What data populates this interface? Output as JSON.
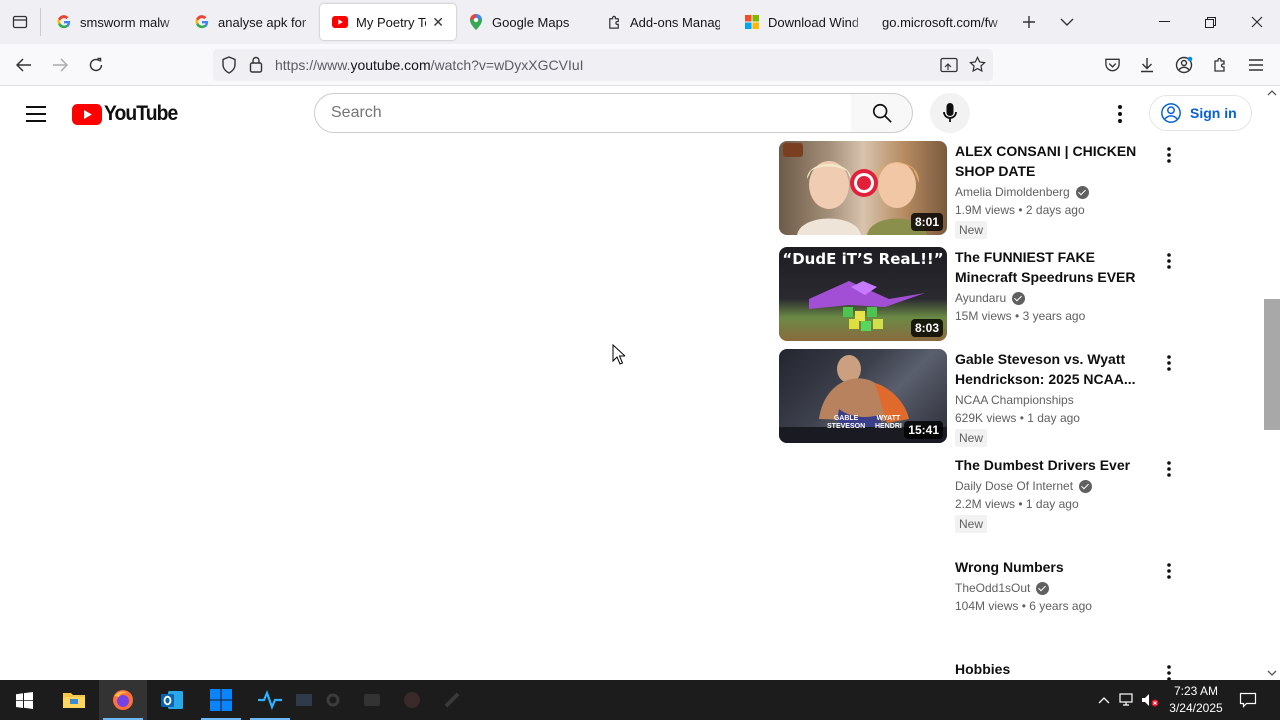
{
  "browser": {
    "tabs": [
      {
        "title": "smsworm malware",
        "favicon": "google-g-icon",
        "active": false
      },
      {
        "title": "analyse apk for malware",
        "favicon": "google-g-icon",
        "active": false
      },
      {
        "title": "My Poetry Teacher",
        "favicon": "youtube-icon",
        "active": true,
        "close": "✕"
      },
      {
        "title": "Google Maps",
        "favicon": "maps-pin-icon",
        "active": false
      },
      {
        "title": "Add-ons Manager",
        "favicon": "puzzle-icon",
        "active": false
      },
      {
        "title": "Download Windows",
        "favicon": "microsoft-icon",
        "active": false
      },
      {
        "title": "go.microsoft.com/fwlink",
        "favicon": "none",
        "active": false
      }
    ],
    "url_prefix": "https://www.",
    "url_domain": "youtube.com",
    "url_path": "/watch?v=wDyxXGCVIuI"
  },
  "youtube": {
    "logo_text": "YouTube",
    "search_placeholder": "Search",
    "signin_label": "Sign in"
  },
  "videos": [
    {
      "title": "ALEX CONSANI | CHICKEN SHOP DATE",
      "channel": "Amelia Dimoldenberg",
      "verified": true,
      "views": "1.9M views",
      "age": "2 days ago",
      "badge": "New",
      "duration": "8:01",
      "thumb": true
    },
    {
      "title": "The FUNNIEST FAKE Minecraft Speedruns EVER",
      "channel": "Ayundaru",
      "verified": true,
      "views": "15M views",
      "age": "3 years ago",
      "badge": "",
      "duration": "8:03",
      "thumb": true,
      "thumb_text": "“DudE iT’S ReaL!!”"
    },
    {
      "title": "Gable Steveson vs. Wyatt Hendrickson: 2025 NCAA...",
      "channel": "NCAA Championships",
      "verified": false,
      "views": "629K views",
      "age": "1 day ago",
      "badge": "New",
      "duration": "15:41",
      "thumb": true
    },
    {
      "title": "The Dumbest Drivers Ever",
      "channel": "Daily Dose Of Internet",
      "verified": true,
      "views": "2.2M views",
      "age": "1 day ago",
      "badge": "New",
      "duration": "",
      "thumb": false
    },
    {
      "title": "Wrong Numbers",
      "channel": "TheOdd1sOut",
      "verified": true,
      "views": "104M views",
      "age": "6 years ago",
      "badge": "",
      "duration": "",
      "thumb": false
    },
    {
      "title": "Hobbies",
      "channel": "",
      "verified": false,
      "views": "",
      "age": "",
      "badge": "",
      "duration": "",
      "thumb": false
    }
  ],
  "taskbar": {
    "time": "7:23 AM",
    "date": "3/24/2025"
  },
  "colors": {
    "yt_red": "#ff0000",
    "link_blue": "#065fd4",
    "taskbar_bg": "#1c1c1c"
  }
}
